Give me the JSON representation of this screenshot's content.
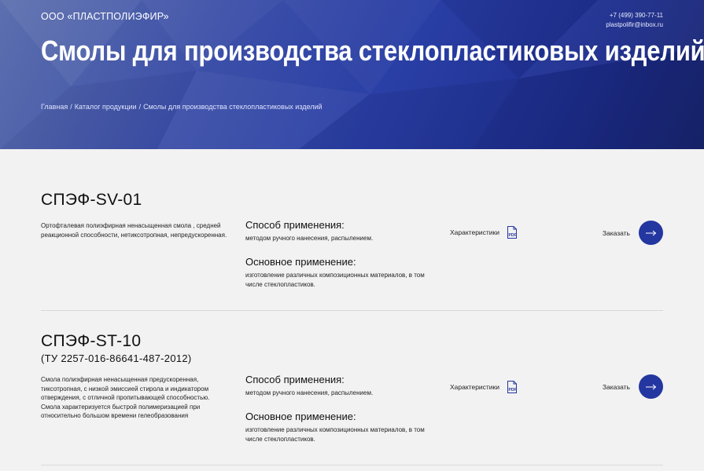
{
  "header": {
    "company": "ООО «ПЛАСТПОЛИЭФИР»",
    "phone": "+7 (499) 390-77-11",
    "email": "plastpolifir@inbox.ru",
    "title": "Смолы для производства стеклопластиковых изделий",
    "breadcrumb": [
      "Главная",
      "Каталог продукции",
      "Смолы для производства стеклопластиковых изделий"
    ]
  },
  "products": [
    {
      "name": "СПЭФ-SV-01",
      "subtitle": "",
      "description": "Ортофталевая полиэфирная ненасыщенная смола , средней реакционной способности, нетиксотропная, непредускоренная.",
      "method_heading": "Способ применения:",
      "method_text": "методом ручного нанесения, распылением.",
      "usage_heading": "Основное применение:",
      "usage_text": "изготовление различных композиционных материалов, в том числе стеклопластиков.",
      "spec_label": "Характеристики",
      "order_label": "Заказать"
    },
    {
      "name": "СПЭФ-ST-10",
      "subtitle": "(ТУ 2257-016-86641-487-2012)",
      "description": "Смола полиэфирная ненасыщенная предускоренная, тиксотропная, с низкой эмиссией стирола и индикатором отверждения, с отличной пропитывающей способностью. Смола характеризуется быстрой полимеризацией при относительно большом времени гелеобразования",
      "method_heading": "Способ применения:",
      "method_text": "методом ручного нанесения, распылением.",
      "usage_heading": "Основное применение:",
      "usage_text": "изготовление различных композиционных материалов, в том числе стеклопластиков.",
      "spec_label": "Характеристики",
      "order_label": "Заказать"
    }
  ],
  "colors": {
    "accent": "#2436a0",
    "hero_dark": "#1a2670",
    "background": "#f2f2f2"
  },
  "icons": {
    "pdf": "pdf-icon",
    "arrow": "arrow-right-icon"
  }
}
